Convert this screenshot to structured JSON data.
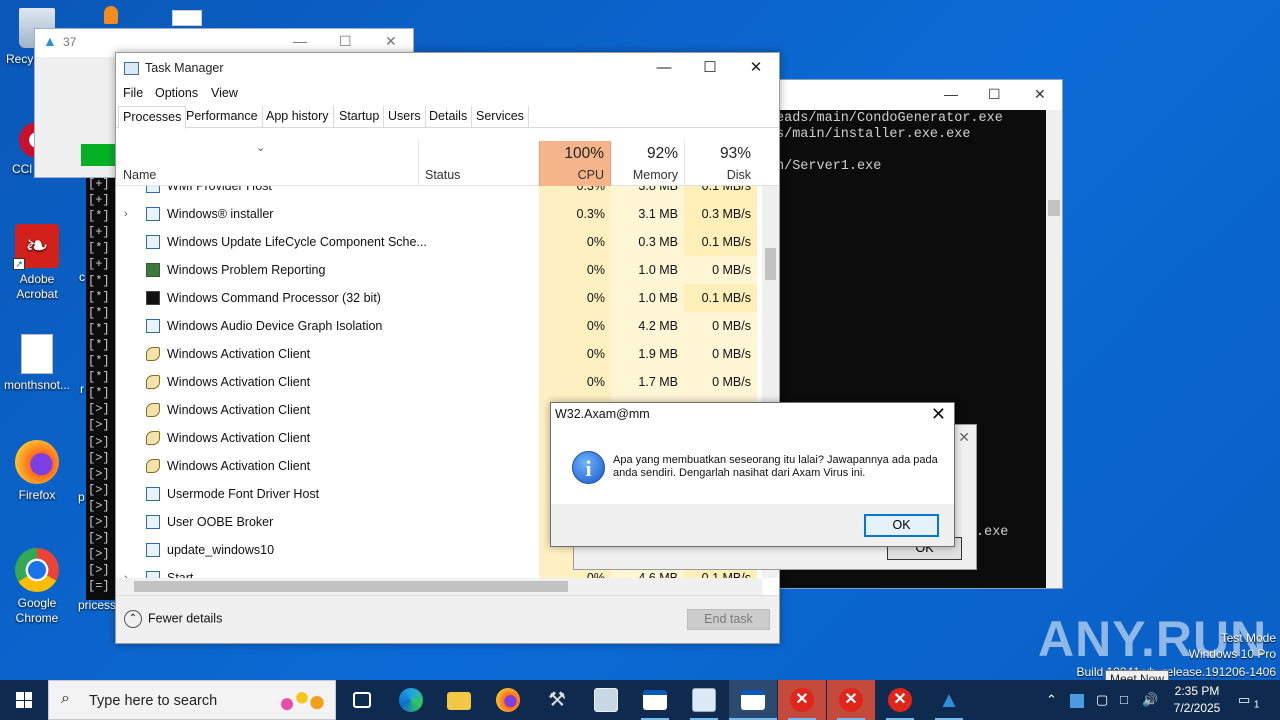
{
  "desktop": {
    "icons": [
      {
        "label": "Recy",
        "icon": "recycle-bin-icon"
      },
      {
        "label": "CCl",
        "icon": "ccleaner-icon"
      },
      {
        "label": "Adobe Acrobat",
        "icon": "acrobat-icon"
      },
      {
        "label": "monthsnot...",
        "icon": "image-file-icon"
      },
      {
        "label": "Firefox",
        "icon": "firefox-icon"
      },
      {
        "label": "Google Chrome",
        "icon": "chrome-icon"
      }
    ],
    "partial_labels": [
      "c",
      "p",
      "r",
      "pricess"
    ]
  },
  "console": {
    "lines": [
      "eads/main/CondoGenerator.exe",
      "s/main/installer.exe.exe",
      "",
      "n/Server1.exe"
    ],
    "bottom_line": ".exe"
  },
  "left_console": {
    "lines": [
      "[+]",
      "[+]",
      "[*]",
      "[+]",
      "[*]",
      "[+]",
      "[*]",
      "[*]",
      "[*]",
      "[*]",
      "[*]",
      "[*]",
      "[*]",
      "[*]",
      "[>]",
      "[>]",
      "[>]",
      "[>]",
      "[>]",
      "[>]",
      "[>]",
      "[>]",
      "[>]",
      "[>]",
      "[>]",
      "[=]"
    ]
  },
  "window37": {
    "title": "37",
    "progress_fraction": 0.1
  },
  "taskmanager": {
    "title": "Task Manager",
    "menu": [
      "File",
      "Options",
      "View"
    ],
    "tabs": [
      "Processes",
      "Performance",
      "App history",
      "Startup",
      "Users",
      "Details",
      "Services"
    ],
    "active_tab": "Processes",
    "columns": {
      "name": "Name",
      "status": "Status",
      "cpu": {
        "pct": "100%",
        "label": "CPU"
      },
      "memory": {
        "pct": "92%",
        "label": "Memory"
      },
      "disk": {
        "pct": "93%",
        "label": "Disk"
      }
    },
    "rows": [
      {
        "name": "WMI Provider Host",
        "expand": "",
        "icon": "generic",
        "cpu": "0.3%",
        "mem": "3.8 MB",
        "disk": "0.1 MB/s",
        "partial": "top"
      },
      {
        "name": "Windows® installer",
        "expand": ">",
        "icon": "installer",
        "cpu": "0.3%",
        "mem": "3.1 MB",
        "disk": "0.3 MB/s"
      },
      {
        "name": "Windows Update LifeCycle Component Sche...",
        "expand": "",
        "icon": "generic",
        "cpu": "0%",
        "mem": "0.3 MB",
        "disk": "0.1 MB/s"
      },
      {
        "name": "Windows Problem Reporting",
        "expand": "",
        "icon": "err",
        "cpu": "0%",
        "mem": "1.0 MB",
        "disk": "0 MB/s"
      },
      {
        "name": "Windows Command Processor (32 bit)",
        "expand": "",
        "icon": "cmd",
        "cpu": "0%",
        "mem": "1.0 MB",
        "disk": "0.1 MB/s"
      },
      {
        "name": "Windows Audio Device Graph Isolation",
        "expand": "",
        "icon": "generic",
        "cpu": "0%",
        "mem": "4.2 MB",
        "disk": "0 MB/s"
      },
      {
        "name": "Windows Activation Client",
        "expand": "",
        "icon": "key",
        "cpu": "0%",
        "mem": "1.9 MB",
        "disk": "0 MB/s"
      },
      {
        "name": "Windows Activation Client",
        "expand": "",
        "icon": "key",
        "cpu": "0%",
        "mem": "1.7 MB",
        "disk": "0 MB/s"
      },
      {
        "name": "Windows Activation Client",
        "expand": "",
        "icon": "key",
        "cpu": "",
        "mem": "",
        "disk": ""
      },
      {
        "name": "Windows Activation Client",
        "expand": "",
        "icon": "key",
        "cpu": "",
        "mem": "",
        "disk": ""
      },
      {
        "name": "Windows Activation Client",
        "expand": "",
        "icon": "key",
        "cpu": "",
        "mem": "",
        "disk": ""
      },
      {
        "name": "Usermode Font Driver Host",
        "expand": "",
        "icon": "generic",
        "cpu": "",
        "mem": "",
        "disk": ""
      },
      {
        "name": "User OOBE Broker",
        "expand": "",
        "icon": "generic",
        "cpu": "",
        "mem": "",
        "disk": ""
      },
      {
        "name": "update_windows10",
        "expand": "",
        "icon": "generic",
        "cpu": "",
        "mem": "",
        "disk": ""
      },
      {
        "name": "Start",
        "expand": ">",
        "icon": "generic",
        "cpu": "0%",
        "mem": "4.6 MB",
        "disk": "0.1 MB/s",
        "partial": "bottom"
      }
    ],
    "footer": {
      "fewer": "Fewer details",
      "end_task": "End task"
    }
  },
  "dialog": {
    "title": "W32.Axam@mm",
    "message": "Apa yang membuatkan seseorang itu lalai? Jawapannya ada pada anda sendiri. Dengarlah nasihat dari Axam Virus ini.",
    "ok": "OK",
    "icon": "info-icon"
  },
  "dialog_behind": {
    "ok": "OK",
    "close": "✕"
  },
  "watermark": {
    "brand": "ANY.RUN",
    "mode": "Test Mode",
    "os": "Windows 10 Pro",
    "build": "Build 19041.vb_release.191206-1406"
  },
  "tooltip": "Meet Now",
  "taskbar": {
    "search_placeholder": "Type here to search",
    "clock_time": "2:35 PM",
    "clock_date": "7/2/2025",
    "notification_count": "1"
  }
}
